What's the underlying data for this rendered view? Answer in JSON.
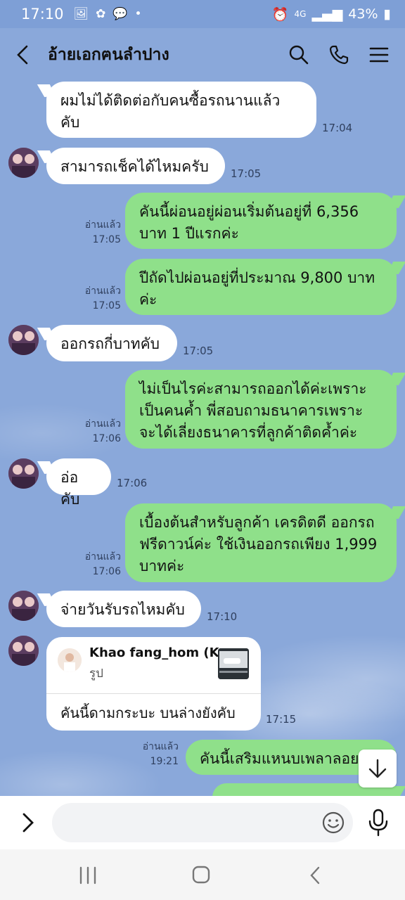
{
  "status_bar": {
    "time": "17:10",
    "battery": "43%",
    "network": "4G"
  },
  "header": {
    "title": "อ้ายเอกฅนลำปาง"
  },
  "messages": [
    {
      "side": "in",
      "text_lines": [
        "ผมไม่ได้ติดต่อกับคนซื้อรถนานแล้ว",
        "คับ"
      ],
      "time": "17:04"
    },
    {
      "side": "in",
      "text_lines": [
        "สามารถเช็คได้ไหมครับ"
      ],
      "time": "17:05"
    },
    {
      "side": "out",
      "text_lines": [
        "คันนี้ผ่อนอยู่ผ่อนเริ่มต้นอยู่ที่ 6,356",
        "บาท 1 ปีแรกค่ะ"
      ],
      "read": "อ่านแล้ว",
      "time": "17:05"
    },
    {
      "side": "out",
      "text_lines": [
        "ปีถัดไปผ่อนอยู่ที่ประมาณ 9,800 บาท",
        "ค่ะ"
      ],
      "read": "อ่านแล้ว",
      "time": "17:05"
    },
    {
      "side": "in",
      "text_lines": [
        "ออกรถกี่บาทคับ"
      ],
      "time": "17:05"
    },
    {
      "side": "out",
      "text_lines": [
        "ไม่เป็นไรค่ะสามารถออกได้ค่ะเพราะ",
        "เป็นคนค้ำ พี่สอบถามธนาคารเพราะ",
        "จะได้เลี่ยงธนาคารที่ลูกค้าติดค้ำค่ะ"
      ],
      "read": "อ่านแล้ว",
      "time": "17:06"
    },
    {
      "side": "in",
      "text_lines": [
        "อ่อคับ"
      ],
      "time": "17:06"
    },
    {
      "side": "out",
      "text_lines": [
        "เบื้องต้นสำหรับลูกค้า เครดิตดี ออกรถ",
        "ฟรีดาวน์ค่ะ ใช้เงินออกรถเพียง 1,999",
        "บาทค่ะ"
      ],
      "read": "อ่านแล้ว",
      "time": "17:06"
    },
    {
      "side": "in",
      "text_lines": [
        "จ่ายวันรับรถไหมคับ"
      ],
      "time": "17:10"
    },
    {
      "side": "in",
      "reply_name": "Khao fang_hom (K...",
      "reply_sub": "รูป",
      "text_lines": [
        "คันนี้ดามกระบะ บนล่างยังคับ"
      ],
      "time": "17:15"
    },
    {
      "side": "out",
      "text_lines": [
        "คันนี้เสริมแหนบเพลาลอยค่ะ"
      ],
      "read": "อ่านแล้ว",
      "time": "19:21"
    }
  ],
  "colors": {
    "background": "#8aa8da",
    "incoming_bubble": "#ffffff",
    "outgoing_bubble": "#8fe08a"
  }
}
